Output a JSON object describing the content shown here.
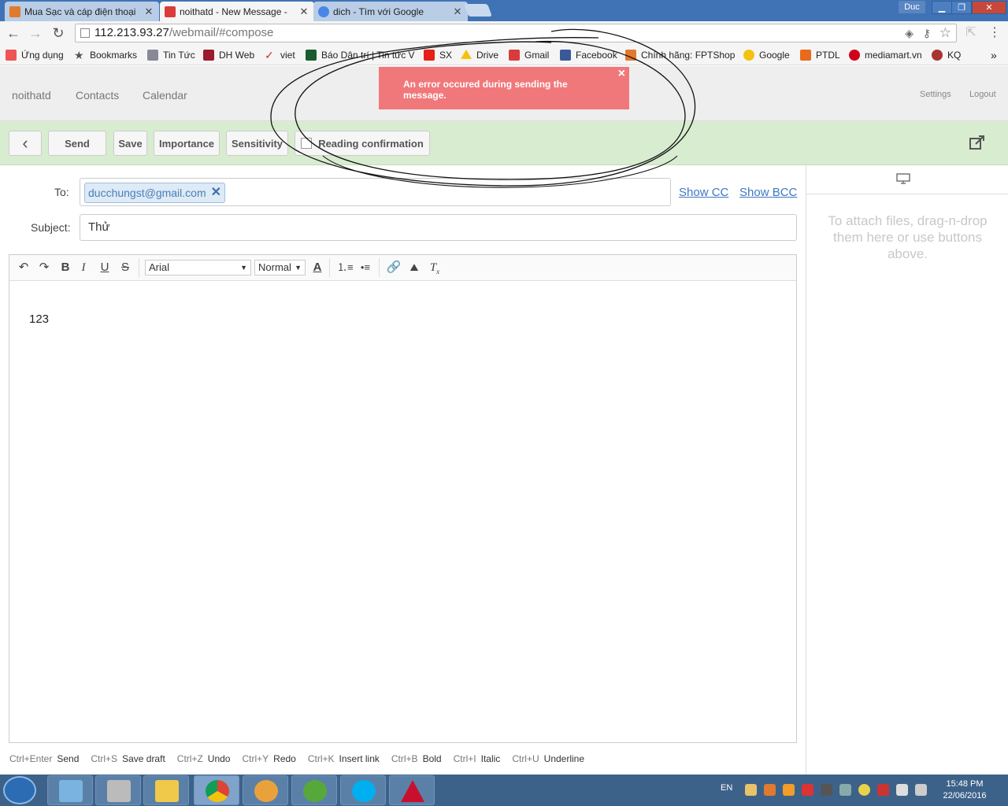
{
  "browser": {
    "tabs": [
      {
        "label": "Mua Sạc và cáp điện thoại",
        "active": false
      },
      {
        "label": "noithatd - New Message -",
        "active": true
      },
      {
        "label": "dich - Tìm với Google",
        "active": false
      }
    ],
    "profile": "Duc",
    "url_host": "112.213.93.27",
    "url_path": "/webmail/#compose",
    "bookmarks": [
      "Ứng dụng",
      "Bookmarks",
      "Tin Tức",
      "DH Web",
      "viet",
      "Báo Dân trí | Tin tức V",
      "SX",
      "Drive",
      "Gmail",
      "Facebook",
      "Chính hãng: FPTShop",
      "Google",
      "PTDL",
      "mediamart.vn",
      "KQ"
    ],
    "overflow": "»"
  },
  "app": {
    "nav": [
      "noithatd",
      "Contacts",
      "Calendar"
    ],
    "settings": "Settings",
    "logout": "Logout"
  },
  "toast": {
    "message": "An error occured during sending the message.",
    "close": "×"
  },
  "compose_toolbar": {
    "back": "‹",
    "send": "Send",
    "save": "Save",
    "importance": "Importance",
    "sensitivity": "Sensitivity",
    "reading_confirmation": "Reading confirmation"
  },
  "form": {
    "to_label": "To:",
    "recipient": "ducchungst@gmail.com",
    "show_cc": "Show CC",
    "show_bcc": "Show BCC",
    "subject_label": "Subject:",
    "subject": "Thử"
  },
  "editor": {
    "font": "Arial",
    "size": "Normal",
    "body": "123"
  },
  "attachments": {
    "hint": "To attach files, drag-n-drop them here or use buttons above."
  },
  "shortcuts": [
    {
      "key": "Ctrl+Enter",
      "action": "Send"
    },
    {
      "key": "Ctrl+S",
      "action": "Save draft"
    },
    {
      "key": "Ctrl+Z",
      "action": "Undo"
    },
    {
      "key": "Ctrl+Y",
      "action": "Redo"
    },
    {
      "key": "Ctrl+K",
      "action": "Insert link"
    },
    {
      "key": "Ctrl+B",
      "action": "Bold"
    },
    {
      "key": "Ctrl+I",
      "action": "Italic"
    },
    {
      "key": "Ctrl+U",
      "action": "Underline"
    }
  ],
  "taskbar": {
    "lang": "EN",
    "time": "15:48 PM",
    "date": "22/06/2016"
  },
  "colors": {
    "toast_bg": "#f0787b",
    "compose_bar_bg": "#d8ecd0",
    "link": "#3d77c4"
  }
}
